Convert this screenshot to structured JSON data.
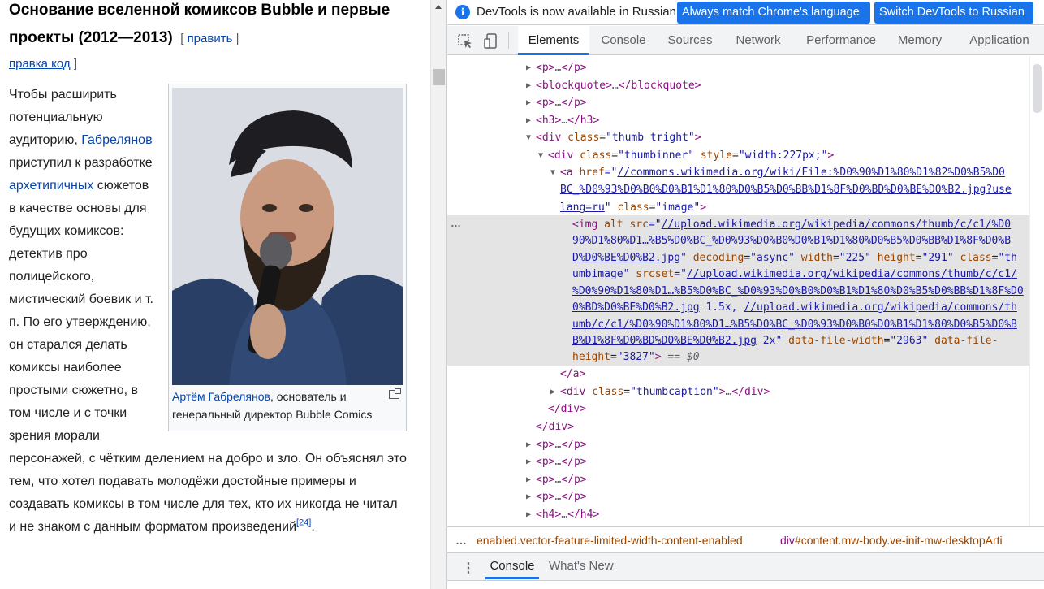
{
  "wiki": {
    "heading": "Основание вселенной комиксов Bubble и первые проекты (2012—2013)",
    "edit_links": {
      "open": "[",
      "edit": "править",
      "sep": "|",
      "edit_code": "правка код",
      "close": "]"
    },
    "paragraph": {
      "t1": "Чтобы расширить потенциальную аудиторию,",
      "link1": "Габрелянов",
      "t2": "приступил к разработке",
      "link2": "архетипичных",
      "t3": "сюжетов в качестве основы для будущих комиксов: детектив про полицейского, мистический боевик и т. п. По его утверждению, он старался делать комиксы наиболее простыми сюжетно, в том числе и с точки зрения морали персонажей, с чётким делением на добро и зло. Он объяснял это тем, что хотел подавать молодёжи достойные примеры и создавать комиксы в том числе для тех, кто их никогда не читал и не знаком с данным форматом произведений",
      "ref": "[24]",
      "t4": "."
    },
    "caption": {
      "link": "Артём Габрелянов",
      "text": ", основатель и генеральный директор Bubble Comics"
    }
  },
  "devtools": {
    "infobar": {
      "message": "DevTools is now available in Russian!",
      "btn_match": "Always match Chrome's language",
      "btn_switch": "Switch DevTools to Russian"
    },
    "tabs": [
      "Elements",
      "Console",
      "Sources",
      "Network",
      "Performance",
      "Memory",
      "Application"
    ],
    "active_tab": "Elements",
    "dom": {
      "l1": {
        "a": "<p>",
        "b": "…",
        "c": "</p>"
      },
      "l2": {
        "a": "<blockquote>",
        "b": "…",
        "c": "</blockquote>"
      },
      "l3": {
        "a": "<p>",
        "b": "…",
        "c": "</p>"
      },
      "l4": {
        "a": "<h3>",
        "b": "…",
        "c": "</h3>"
      },
      "l5": {
        "open": "<div",
        "attr": "class",
        "val": "\"thumb tright\"",
        "close": ">"
      },
      "l6": {
        "open": "<div",
        "attr1": "class",
        "val1": "\"thumbinner\"",
        "attr2": "style",
        "val2": "\"width:227px;\"",
        "close": ">"
      },
      "l7": {
        "open": "<a",
        "attr": "href",
        "eq": "=\"",
        "link": "//commons.wikimedia.org/wiki/File:%D0%90%D1%80%D1%82%D0%B5%D0"
      },
      "l8": {
        "link": "BC_%D0%93%D0%B0%D0%B1%D1%80%D0%B5%D0%BB%D1%8F%D0%BD%D0%BE%D0%B2.jpg?use"
      },
      "l9": {
        "link": "lang=ru",
        "q": "\"",
        "attr": "class",
        "val": "\"image\"",
        "close": ">"
      },
      "l10": {
        "open": "<img",
        "attr1": "alt",
        "attr2": "src",
        "eq": "=\"",
        "link": "//upload.wikimedia.org/wikipedia/commons/thumb/c/c1/%D0"
      },
      "l11": {
        "link": "90%D1%80%D1…%B5%D0%BC_%D0%93%D0%B0%D0%B1%D1%80%D0%B5%D0%BB%D1%8F%D0%B"
      },
      "l12": {
        "link": "D%D0%BE%D0%B2.jpg",
        "q": "\"",
        "attr1": "decoding",
        "val1": "\"async\"",
        "attr2": "width",
        "val2": "\"225\"",
        "attr3": "height",
        "val3": "\"291\"",
        "attr4": "class",
        "val4": "\"th"
      },
      "l13": {
        "val": "umbimage\"",
        "attr": "srcset",
        "eq": "=\"",
        "link": "//upload.wikimedia.org/wikipedia/commons/thumb/c/c1/"
      },
      "l14": {
        "link": "%D0%90%D1%80%D1…%B5%D0%BC_%D0%93%D0%B0%D0%B1%D1%80%D0%B5%D0%BB%D1%8F%D0"
      },
      "l15": {
        "link": "0%BD%D0%BE%D0%B2.jpg",
        "mid": " 1.5x, ",
        "link2": "//upload.wikimedia.org/wikipedia/commons/th"
      },
      "l16": {
        "link": "umb/c/c1/%D0%90%D1%80%D1…%B5%D0%BC_%D0%93%D0%B0%D0%B1%D1%80%D0%B5%D0%B"
      },
      "l17": {
        "link": "B%D1%8F%D0%BD%D0%BE%D0%B2.jpg",
        "mid": " 2x\"",
        "attr1": "data-file-width",
        "val1": "\"2963\"",
        "attr2": "data-file-"
      },
      "l18": {
        "attr": "height",
        "val": "\"3827\"",
        "close": ">",
        "eq0": "== $0"
      },
      "l19": {
        "a": "</a>"
      },
      "l20": {
        "open": "<div",
        "attr": "class",
        "val": "\"thumbcaption\"",
        "close": ">",
        "b": "…",
        "c": "</div>"
      },
      "l21": {
        "a": "</div>"
      },
      "l22": {
        "a": "</div>"
      },
      "l23": {
        "a": "<p>",
        "b": "…",
        "c": "</p>"
      },
      "l24": {
        "a": "<p>",
        "b": "…",
        "c": "</p>"
      },
      "l25": {
        "a": "<p>",
        "b": "…",
        "c": "</p>"
      },
      "l26": {
        "a": "<p>",
        "b": "…",
        "c": "</p>"
      },
      "l27": {
        "a": "<h4>",
        "b": "…",
        "c": "</h4>"
      },
      "selected_dots": "…"
    },
    "breadcrumbs": {
      "more": "…",
      "c1": "enabled.vector-feature-limited-width-content-enabled",
      "c2_tag": "div",
      "c2_rest": "#content.mw-body.ve-init-mw-desktopArti"
    },
    "drawer": {
      "menu": "⋮",
      "tabs": [
        "Console",
        "What's New"
      ]
    }
  }
}
